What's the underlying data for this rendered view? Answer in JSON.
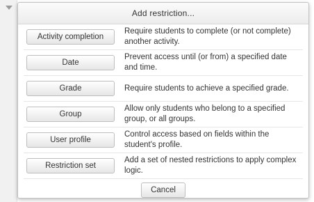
{
  "dialog": {
    "title": "Add restriction...",
    "options": [
      {
        "button_label": "Activity completion",
        "description": "Require students to complete (or not complete) another activity."
      },
      {
        "button_label": "Date",
        "description": "Prevent access until (or from) a specified date and time."
      },
      {
        "button_label": "Grade",
        "description": "Require students to achieve a specified grade."
      },
      {
        "button_label": "Group",
        "description": "Allow only students who belong to a specified group, or all groups."
      },
      {
        "button_label": "User profile",
        "description": "Control access based on fields within the student's profile."
      },
      {
        "button_label": "Restriction set",
        "description": "Add a set of nested restrictions to apply complex logic."
      }
    ],
    "cancel_label": "Cancel"
  },
  "background": {
    "caret_icon": "caret-down-icon"
  }
}
